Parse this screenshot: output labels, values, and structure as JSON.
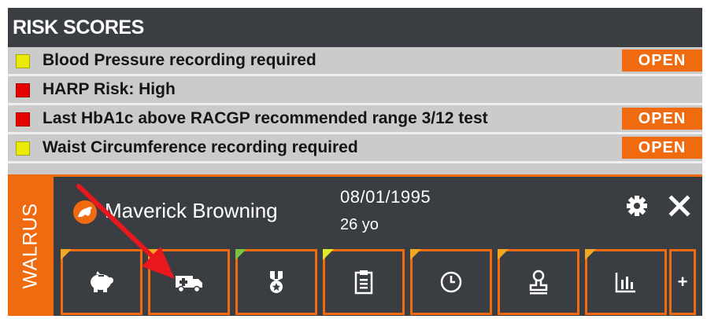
{
  "risk_scores": {
    "title": "RISK SCORES",
    "items": [
      {
        "label": "Blood Pressure recording required",
        "status": "yellow",
        "action": "OPEN"
      },
      {
        "label": "HARP Risk: High",
        "status": "red",
        "action": ""
      },
      {
        "label": "Last HbA1c above RACGP recommended range 3/12 test",
        "status": "red",
        "action": "OPEN"
      },
      {
        "label": "Waist Circumference recording required",
        "status": "yellow",
        "action": "OPEN"
      }
    ]
  },
  "widget": {
    "side_label": "WALRUS",
    "patient_name": "Maverick Browning",
    "dob": "08/01/1995",
    "age": "26 yo",
    "tiles": [
      {
        "icon": "piggy-bank-icon",
        "flag": "orange"
      },
      {
        "icon": "ambulance-icon",
        "flag": "orange"
      },
      {
        "icon": "medal-icon",
        "flag": "green"
      },
      {
        "icon": "clipboard-icon",
        "flag": "yellow"
      },
      {
        "icon": "clock-icon",
        "flag": "orange"
      },
      {
        "icon": "stamp-icon",
        "flag": "orange"
      },
      {
        "icon": "bar-chart-icon",
        "flag": "orange"
      }
    ],
    "more_label": "+"
  },
  "colors": {
    "accent": "#f06a10",
    "dark": "#3a3e43",
    "flag_orange": "#f5a623",
    "flag_green": "#7bc142",
    "flag_yellow": "#e3e62a",
    "annotation_arrow": "#e8181c"
  }
}
